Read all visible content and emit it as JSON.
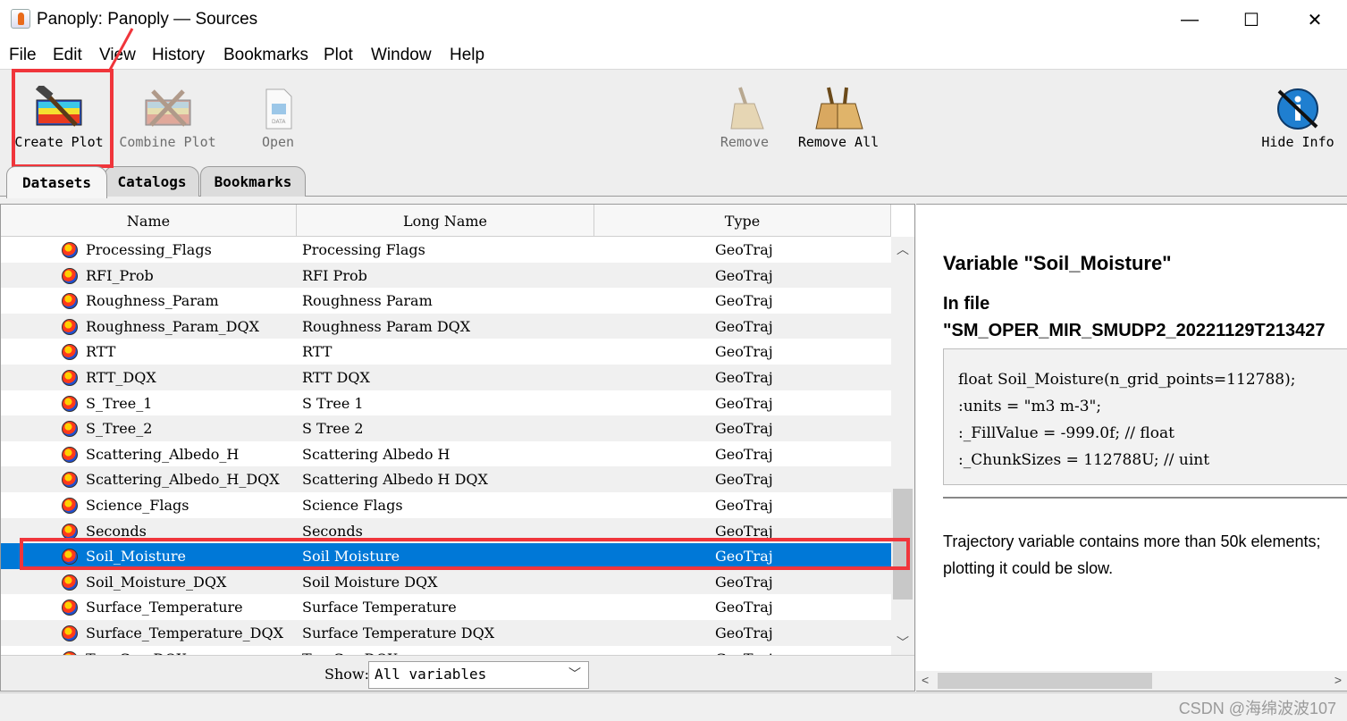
{
  "window": {
    "title": "Panoply: Panoply — Sources",
    "minimize": "—",
    "maximize": "☐",
    "close": "✕"
  },
  "menu": [
    "File",
    "Edit",
    "View",
    "History",
    "Bookmarks",
    "Plot",
    "Window",
    "Help"
  ],
  "toolbar": {
    "create_plot": "Create Plot",
    "combine_plot": "Combine Plot",
    "open": "Open",
    "remove": "Remove",
    "remove_all": "Remove All",
    "hide_info": "Hide Info"
  },
  "tabs": [
    "Datasets",
    "Catalogs",
    "Bookmarks"
  ],
  "table": {
    "headers": [
      "Name",
      "Long Name",
      "Type"
    ],
    "rows": [
      {
        "name": "Processing_Flags",
        "long_name": "Processing Flags",
        "type": "GeoTraj"
      },
      {
        "name": "RFI_Prob",
        "long_name": "RFI Prob",
        "type": "GeoTraj"
      },
      {
        "name": "Roughness_Param",
        "long_name": "Roughness Param",
        "type": "GeoTraj"
      },
      {
        "name": "Roughness_Param_DQX",
        "long_name": "Roughness Param DQX",
        "type": "GeoTraj"
      },
      {
        "name": "RTT",
        "long_name": "RTT",
        "type": "GeoTraj"
      },
      {
        "name": "RTT_DQX",
        "long_name": "RTT DQX",
        "type": "GeoTraj"
      },
      {
        "name": "S_Tree_1",
        "long_name": "S Tree 1",
        "type": "GeoTraj"
      },
      {
        "name": "S_Tree_2",
        "long_name": "S Tree 2",
        "type": "GeoTraj"
      },
      {
        "name": "Scattering_Albedo_H",
        "long_name": "Scattering Albedo H",
        "type": "GeoTraj"
      },
      {
        "name": "Scattering_Albedo_H_DQX",
        "long_name": "Scattering Albedo H DQX",
        "type": "GeoTraj"
      },
      {
        "name": "Science_Flags",
        "long_name": "Science Flags",
        "type": "GeoTraj"
      },
      {
        "name": "Seconds",
        "long_name": "Seconds",
        "type": "GeoTraj"
      },
      {
        "name": "Soil_Moisture",
        "long_name": "Soil Moisture",
        "type": "GeoTraj",
        "selected": true
      },
      {
        "name": "Soil_Moisture_DQX",
        "long_name": "Soil Moisture DQX",
        "type": "GeoTraj"
      },
      {
        "name": "Surface_Temperature",
        "long_name": "Surface Temperature",
        "type": "GeoTraj"
      },
      {
        "name": "Surface_Temperature_DQX",
        "long_name": "Surface Temperature DQX",
        "type": "GeoTraj"
      },
      {
        "name": "Tau_Cur_DQX",
        "long_name": "Tau Cur DQX",
        "type": "GeoTraj"
      }
    ]
  },
  "filter": {
    "label": "Show:",
    "value": "All variables"
  },
  "info": {
    "title": "Variable \"Soil_Moisture\"",
    "in_file": "In file",
    "filename": "\"SM_OPER_MIR_SMUDP2_20221129T213427",
    "code": [
      "float Soil_Moisture(n_grid_points=112788);",
      "  :units = \"m3 m-3\";",
      "  :_FillValue = -999.0f; // float",
      "  :_ChunkSizes = 112788U; // uint"
    ],
    "note": "Trajectory variable contains more than 50k elements; plotting it could be slow."
  },
  "watermark": "CSDN @海绵波波107",
  "colors": {
    "selection": "#0078d7",
    "annotation": "#f0353b"
  }
}
